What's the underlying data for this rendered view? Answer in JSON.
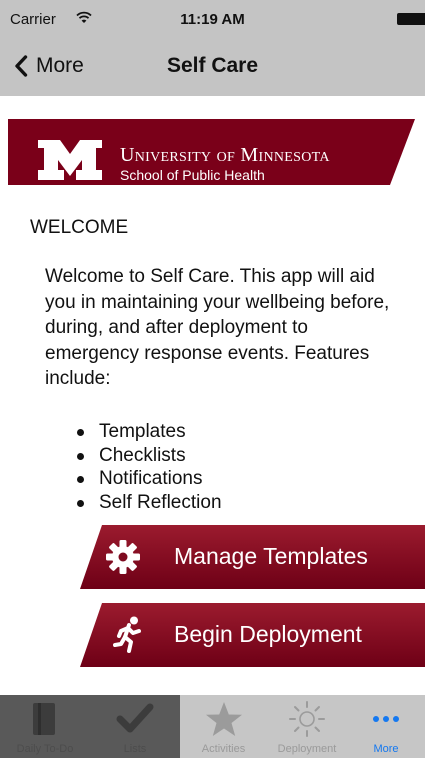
{
  "status_bar": {
    "carrier": "Carrier",
    "time": "11:19 AM"
  },
  "nav": {
    "back_label": "More",
    "title": "Self Care"
  },
  "banner": {
    "university": "University of Minnesota",
    "school": "School of Public Health"
  },
  "welcome": {
    "heading": "WELCOME",
    "text": "Welcome to Self Care. This app will aid you in maintaining your wellbeing before, during, and after deployment to emergency response events. Features include:",
    "features": [
      "Templates",
      "Checklists",
      "Notifications",
      "Self Reflection"
    ]
  },
  "actions": {
    "manage_templates": "Manage Templates",
    "begin_deployment": "Begin Deployment"
  },
  "tabs": [
    {
      "label": "Daily To-Do",
      "icon": "book-icon"
    },
    {
      "label": "Lists",
      "icon": "checkmark-icon"
    },
    {
      "label": "Activities",
      "icon": "star-icon"
    },
    {
      "label": "Deployment",
      "icon": "sun-icon"
    },
    {
      "label": "More",
      "icon": "more-dots-icon"
    }
  ],
  "colors": {
    "brand_maroon": "#7a0019",
    "bars_gray": "#c4c4c4",
    "active_tab_blue": "#1478f0"
  }
}
